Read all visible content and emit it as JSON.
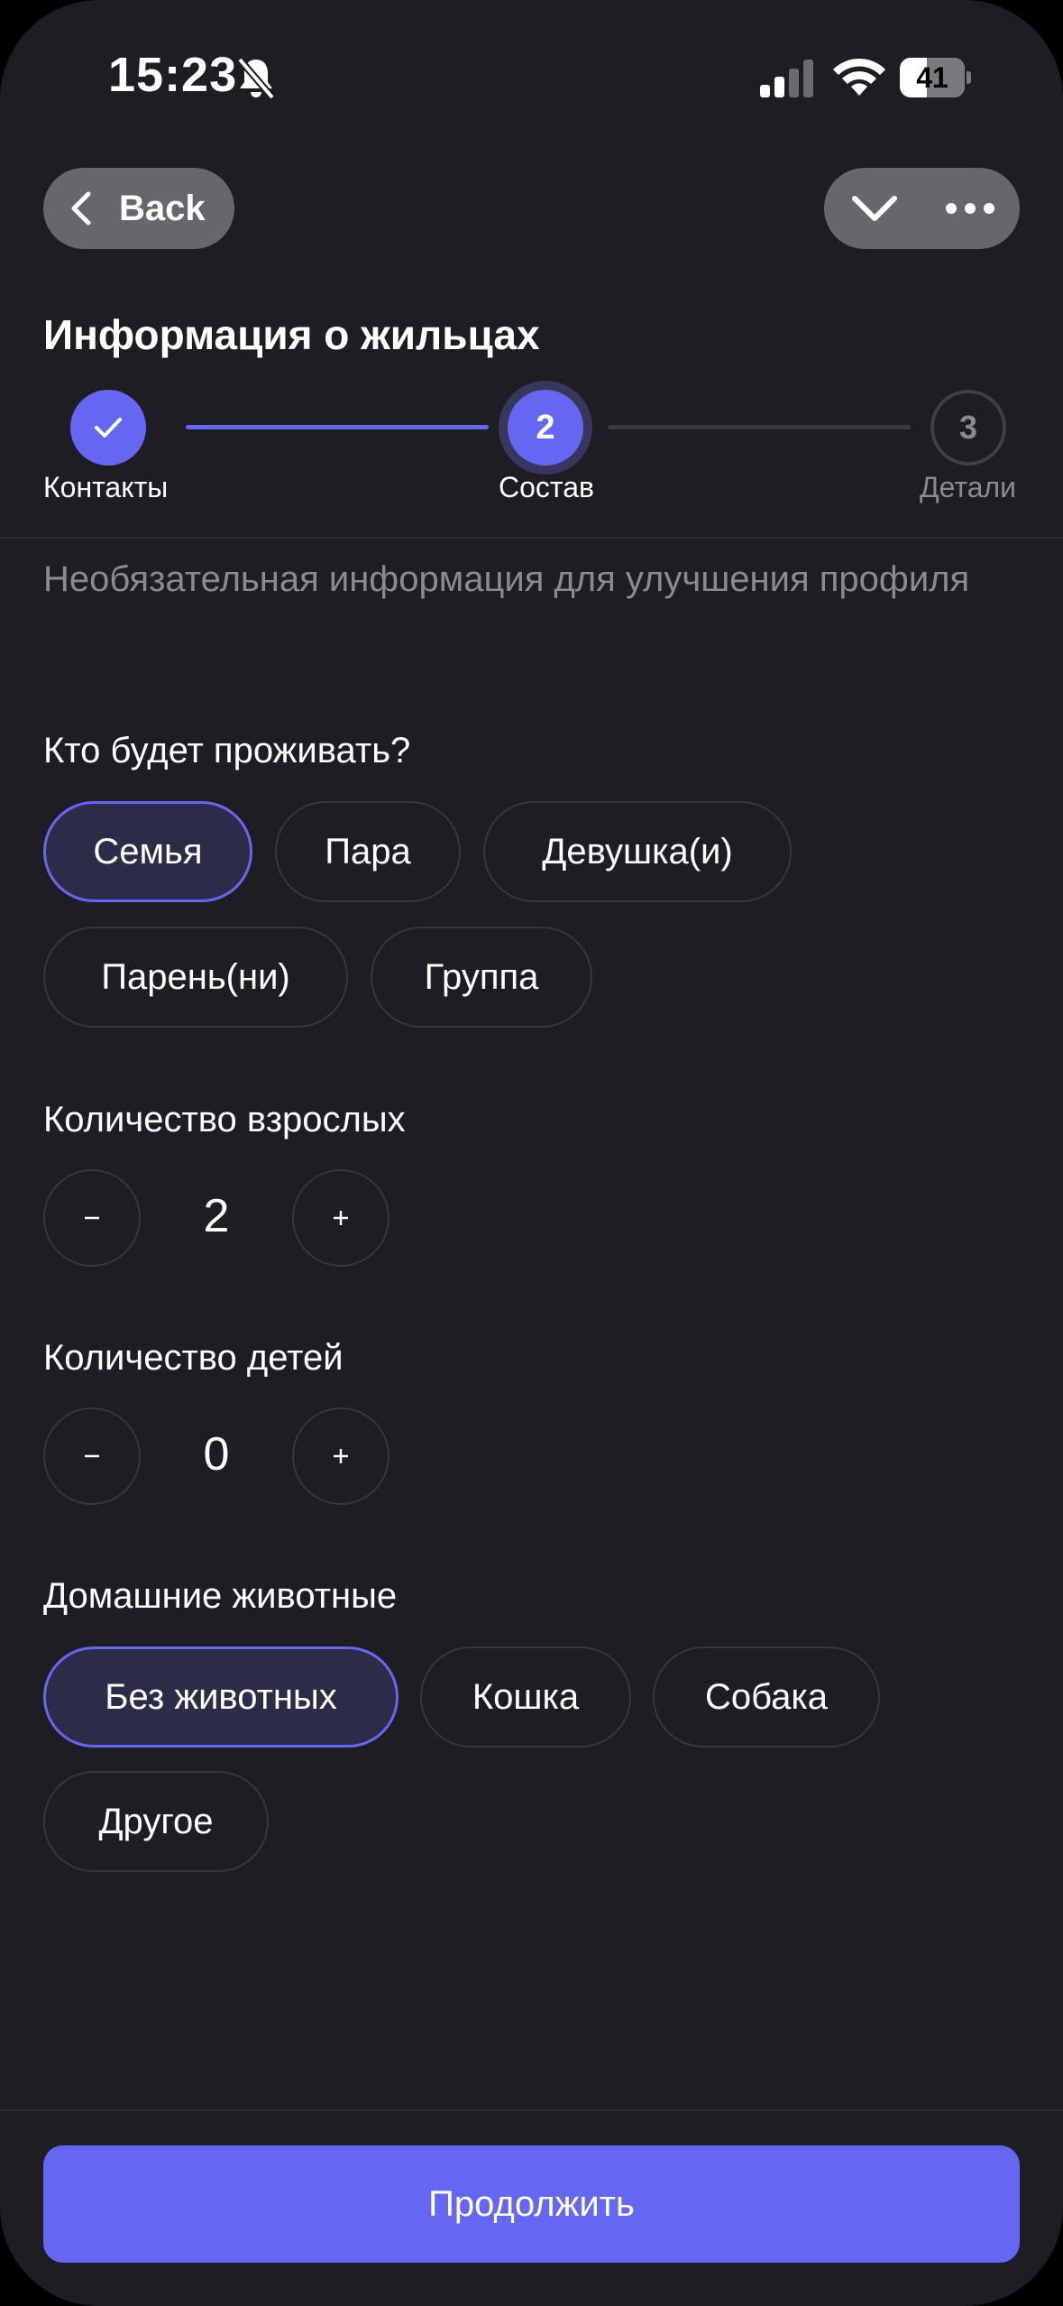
{
  "status_bar": {
    "time": "15:23",
    "battery": "41",
    "battery_level": 0.41
  },
  "nav": {
    "back_label": "Back"
  },
  "page_title": "Информация о жильцах",
  "stepper": {
    "steps": [
      {
        "number": "1",
        "label": "Контакты",
        "state": "completed"
      },
      {
        "number": "2",
        "label": "Состав",
        "state": "active"
      },
      {
        "number": "3",
        "label": "Детали",
        "state": "pending"
      }
    ],
    "accent_color": "#6566f1"
  },
  "subtitle": "Необязательная информация для улучшения профиля",
  "residents": {
    "title": "Кто будет проживать?",
    "options": [
      "Семья",
      "Пара",
      "Девушка(и)",
      "Парень(ни)",
      "Группа"
    ],
    "selected": "Семья"
  },
  "adults": {
    "title": "Количество взрослых",
    "value": "2",
    "minus_label": "−",
    "plus_label": "+"
  },
  "children": {
    "title": "Количество детей",
    "value": "0",
    "minus_label": "−",
    "plus_label": "+"
  },
  "pets": {
    "title": "Домашние животные",
    "options": [
      "Без животных",
      "Кошка",
      "Собака",
      "Другое"
    ],
    "selected": "Без животных"
  },
  "continue_label": "Продолжить",
  "colors": {
    "background": "#1e1d23",
    "accent": "#6566f1",
    "selected_chip_bg": "#2c2c48",
    "muted_text": "#8b8a90"
  }
}
